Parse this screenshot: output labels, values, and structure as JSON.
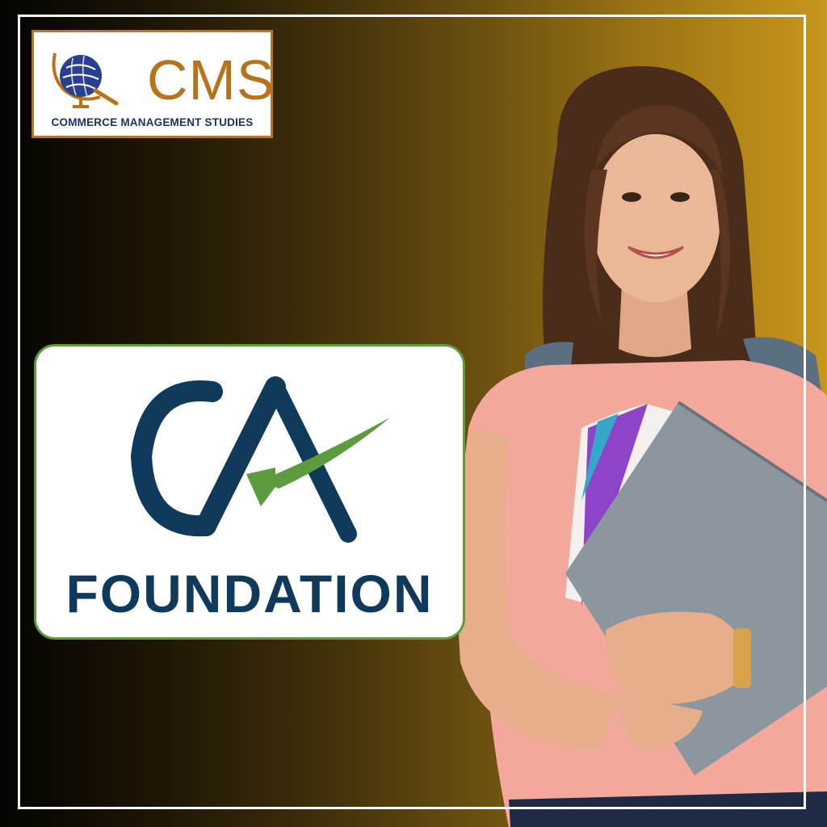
{
  "brand": {
    "name": "CMS",
    "tagline": "COMMERCE MANAGEMENT STUDIES"
  },
  "course": {
    "logo_letters": "CA",
    "title": "FOUNDATION"
  },
  "colors": {
    "brand_orange": "#b8731a",
    "brand_navy": "#1e2f6e",
    "ca_navy": "#0f3a5c",
    "ca_green": "#5d9c3e",
    "background_gold": "#c8961c"
  },
  "icons": [
    "globe-icon",
    "magnifier-icon"
  ]
}
